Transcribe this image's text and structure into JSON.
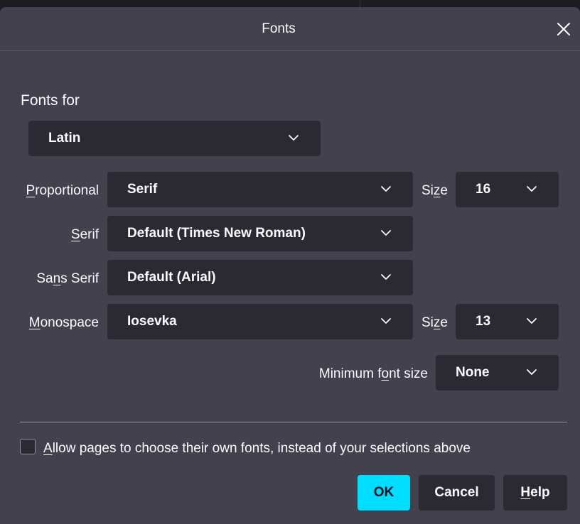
{
  "dialog": {
    "title": "Fonts",
    "close_icon": "close-icon"
  },
  "fonts_for": {
    "heading": "Fonts for",
    "value": "Latin"
  },
  "proportional": {
    "label_pre": "",
    "label_key": "P",
    "label_post": "roportional",
    "value": "Serif",
    "size_label_pre": "Si",
    "size_label_key": "z",
    "size_label_post": "e",
    "size_value": "16"
  },
  "serif": {
    "label_pre": "",
    "label_key": "S",
    "label_post": "erif",
    "value": "Default (Times New Roman)"
  },
  "sans_serif": {
    "label_pre": "Sa",
    "label_key": "n",
    "label_post": "s Serif",
    "value": "Default (Arial)"
  },
  "monospace": {
    "label_pre": "",
    "label_key": "M",
    "label_post": "onospace",
    "value": "Iosevka",
    "size_label_pre": "Si",
    "size_label_key": "z",
    "size_label_post": "e",
    "size_value": "13"
  },
  "minimum": {
    "label_pre": "Minimum f",
    "label_key": "o",
    "label_post": "nt size",
    "value": "None"
  },
  "allow_pages": {
    "label_pre": "",
    "label_key": "A",
    "label_post": "llow pages to choose their own fonts, instead of your selections above",
    "checked": false
  },
  "buttons": {
    "ok": "OK",
    "cancel": "Cancel",
    "help_key": "H",
    "help_post": "elp"
  },
  "colors": {
    "background": "#42414d",
    "field": "#2b2a33",
    "accent": "#00ddff",
    "text": "#fbfbfe"
  }
}
